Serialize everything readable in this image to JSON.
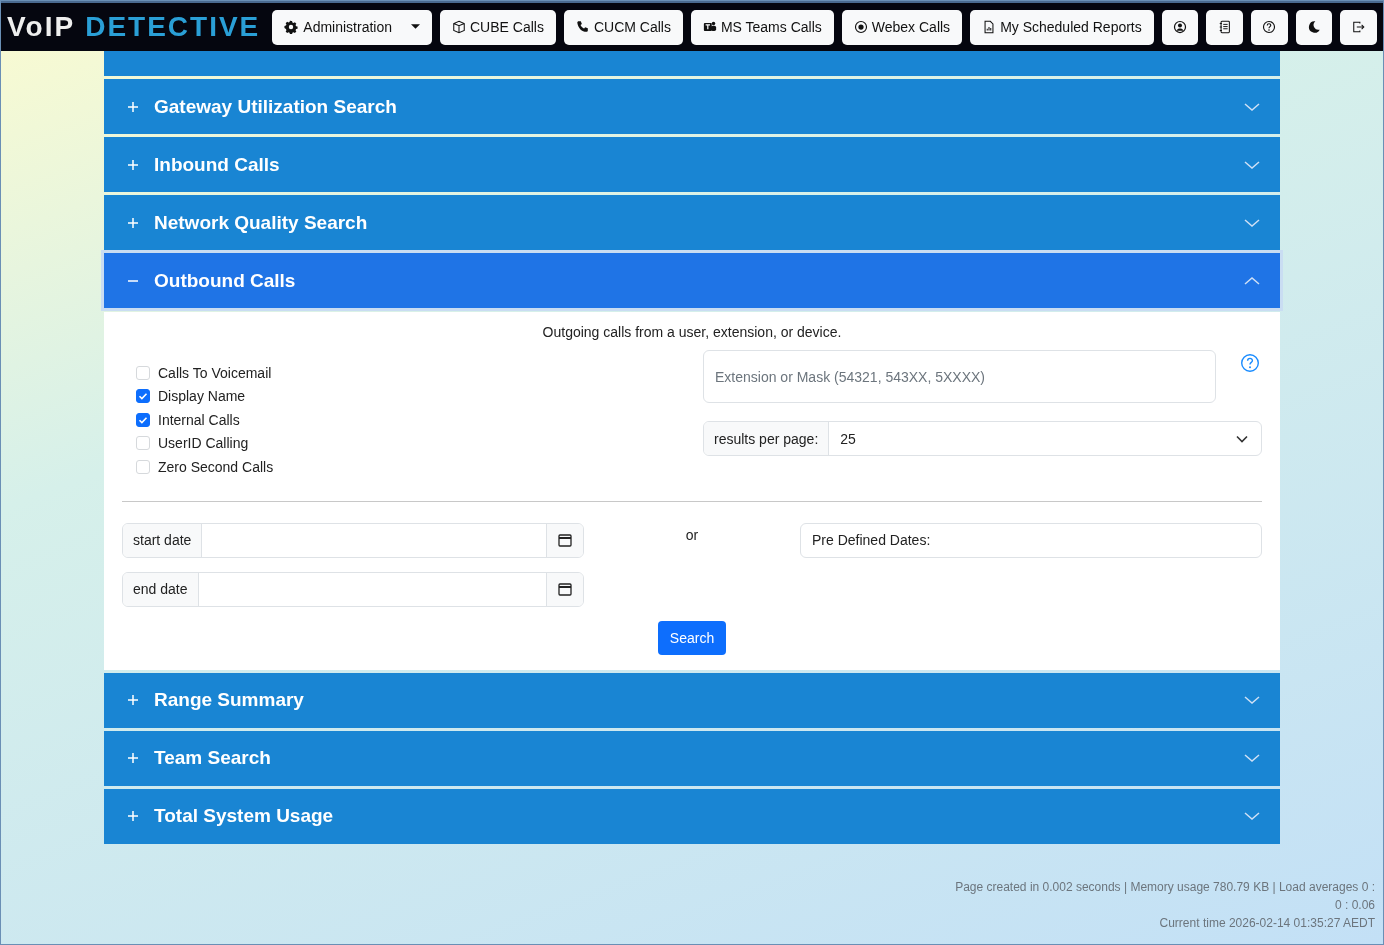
{
  "navbar": {
    "brand": {
      "first": "VoIP",
      "second": "DETECTIVE"
    },
    "menu": [
      {
        "label": "Administration",
        "kind": "dropdown"
      },
      {
        "label": "CUBE Calls",
        "kind": "link"
      },
      {
        "label": "CUCM Calls",
        "kind": "link"
      },
      {
        "label": "MS Teams Calls",
        "kind": "link"
      },
      {
        "label": "Webex Calls",
        "kind": "link"
      },
      {
        "label": "My Scheduled Reports",
        "kind": "link"
      }
    ]
  },
  "accordion": [
    {
      "title": "Gateway Utilization Search",
      "expanded": false
    },
    {
      "title": "Inbound Calls",
      "expanded": false
    },
    {
      "title": "Network Quality Search",
      "expanded": false
    },
    {
      "title": "Outbound Calls",
      "expanded": true
    },
    {
      "title": "Range Summary",
      "expanded": false
    },
    {
      "title": "Team Search",
      "expanded": false
    },
    {
      "title": "Total System Usage",
      "expanded": false
    }
  ],
  "panel": {
    "description": "Outgoing calls from a user, extension, or device.",
    "options": [
      {
        "label": "Calls To Voicemail",
        "checked": false
      },
      {
        "label": "Display Name",
        "checked": true
      },
      {
        "label": "Internal Calls",
        "checked": true
      },
      {
        "label": "UserID Calling",
        "checked": false
      },
      {
        "label": "Zero Second Calls",
        "checked": false
      }
    ],
    "extension_field": {
      "placeholder": "Extension or Mask (54321, 543XX, 5XXXX)"
    },
    "results_per_page": {
      "label": "results per page:",
      "value": "25"
    },
    "start_date": {
      "label": "start date"
    },
    "end_date": {
      "label": "end date"
    },
    "or": "or",
    "predefined_dates": {
      "label": "Pre Defined Dates:"
    },
    "search_button": "Search"
  },
  "footer": [
    "Page created in 0.002 seconds | Memory usage 780.79 KB | Load averages 0 : 0 : 0.06",
    "Current time 2026-02-14 01:35:27 AEDT"
  ]
}
